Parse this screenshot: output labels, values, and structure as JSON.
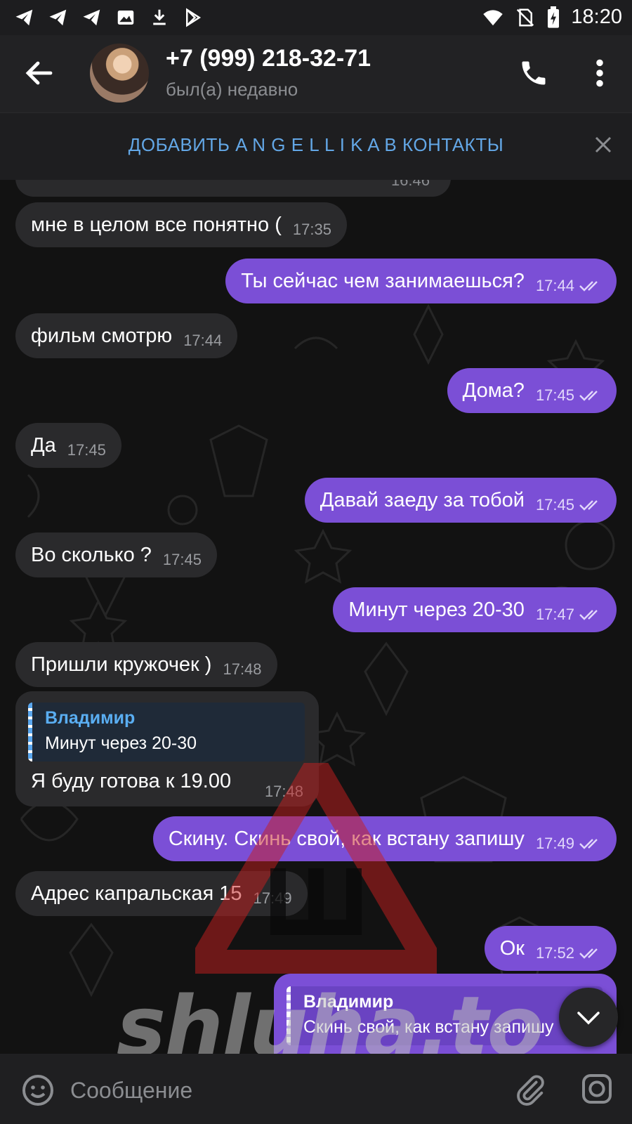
{
  "status_bar": {
    "time": "18:20"
  },
  "header": {
    "title": "+7 (999) 218-32-71",
    "status": "был(а) недавно"
  },
  "add_contact": {
    "label": "ДОБАВИТЬ A N G E L L I K A В КОНТАКТЫ"
  },
  "top_partial_time": "16:46",
  "messages": [
    {
      "dir": "in",
      "text": "мне в целом все понятно (",
      "time": "17:35"
    },
    {
      "dir": "out",
      "text": "Ты сейчас чем занимаешься?",
      "time": "17:44"
    },
    {
      "dir": "in",
      "text": "фильм смотрю",
      "time": "17:44"
    },
    {
      "dir": "out",
      "text": "Дома?",
      "time": "17:45"
    },
    {
      "dir": "in",
      "text": "Да",
      "time": "17:45"
    },
    {
      "dir": "out",
      "text": "Давай заеду за тобой",
      "time": "17:45"
    },
    {
      "dir": "in",
      "text": "Во сколько ?",
      "time": "17:45"
    },
    {
      "dir": "out",
      "text": "Минут через 20-30",
      "time": "17:47"
    },
    {
      "dir": "in",
      "text": "Пришли кружочек )",
      "time": "17:48"
    },
    {
      "dir": "out",
      "text": "Скину. Скинь свой, как встану запишу",
      "time": "17:49"
    },
    {
      "dir": "in",
      "text": "Адрес капральская 15",
      "time": "17:49"
    },
    {
      "dir": "out",
      "text": "Ок",
      "time": "17:52"
    }
  ],
  "reply_in": {
    "quote_name": "Владимир",
    "quote_text": "Минут через 20-30",
    "text": "Я буду готова к 19.00",
    "time": "17:48"
  },
  "reply_out": {
    "quote_name": "Владимир",
    "quote_text": "Скинь свой, как встану запишу"
  },
  "watermark": "shluha.to",
  "input": {
    "placeholder": "Сообщение"
  },
  "colors": {
    "outgoing": "#7b4fd6",
    "incoming": "#2a2a2c",
    "accent": "#63a7e6"
  }
}
